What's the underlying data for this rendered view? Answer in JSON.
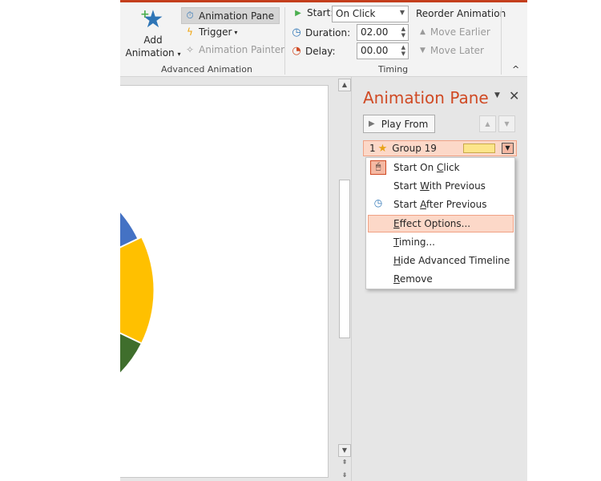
{
  "ribbon": {
    "add_animation": {
      "line1": "Add",
      "line2": "Animation",
      "arrow": "▾"
    },
    "animation_pane_label": "Animation Pane",
    "trigger_label": "Trigger",
    "trigger_arrow": "▾",
    "animation_painter_label": "Animation Painter",
    "advanced_group_label": "Advanced Animation",
    "start_label": "Start:",
    "start_value": "On Click",
    "duration_label": "Duration:",
    "duration_value": "02.00",
    "delay_label": "Delay:",
    "delay_value": "00.00",
    "reorder_label": "Reorder Animation",
    "move_earlier_label": "Move Earlier",
    "move_later_label": "Move Later",
    "timing_group_label": "Timing",
    "collapse_glyph": "^"
  },
  "pane": {
    "title": "Animation Pane",
    "play_from_label": "Play From",
    "items": [
      {
        "number": "1",
        "name": "Group 19"
      }
    ]
  },
  "context_menu": {
    "items": [
      {
        "pre": "Start On ",
        "ul": "C",
        "post": "lick",
        "icon": "mouse-click-icon"
      },
      {
        "pre": "Start ",
        "ul": "W",
        "post": "ith Previous",
        "icon": ""
      },
      {
        "pre": "Start ",
        "ul": "A",
        "post": "fter Previous",
        "icon": "clock-icon"
      },
      {
        "pre": "",
        "ul": "E",
        "post": "ffect Options...",
        "icon": ""
      },
      {
        "pre": "",
        "ul": "T",
        "post": "iming...",
        "icon": ""
      },
      {
        "pre": "",
        "ul": "H",
        "post": "ide Advanced Timeline",
        "icon": ""
      },
      {
        "pre": "",
        "ul": "R",
        "post": "emove",
        "icon": ""
      }
    ]
  },
  "colors": {
    "accent": "#c43e1c",
    "pane_title": "#d04a24",
    "pie_blue": "#4472c4",
    "pie_yellow": "#ffc000",
    "pie_green": "#3f6e2c"
  }
}
